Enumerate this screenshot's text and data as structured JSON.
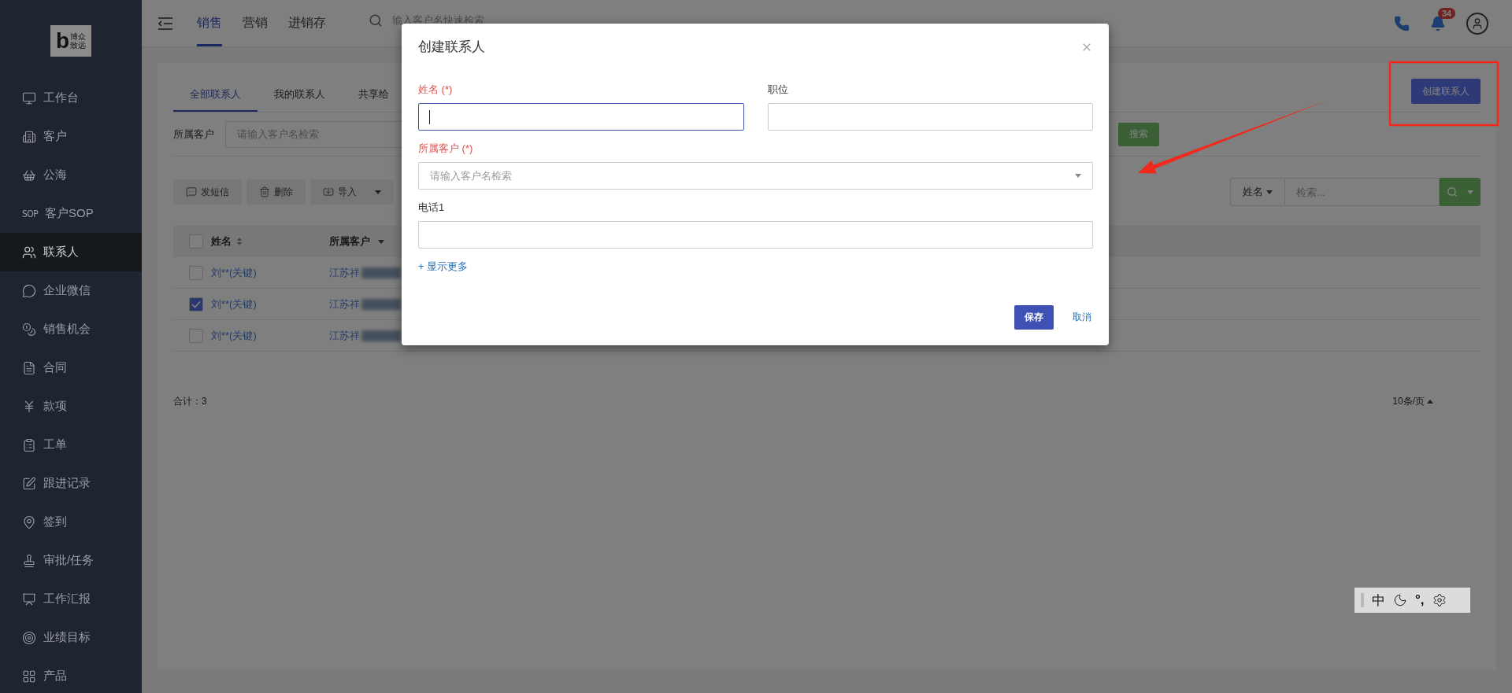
{
  "sidebar": {
    "logo": {
      "mark": "b",
      "text": "博众致远"
    },
    "items": [
      {
        "label": "工作台",
        "selected": false
      },
      {
        "label": "客户",
        "selected": false
      },
      {
        "label": "公海",
        "selected": false
      },
      {
        "label": "客户SOP",
        "icon_text": "SOP",
        "selected": false
      },
      {
        "label": "联系人",
        "selected": true
      },
      {
        "label": "企业微信",
        "selected": false
      },
      {
        "label": "销售机会",
        "selected": false
      },
      {
        "label": "合同",
        "selected": false
      },
      {
        "label": "款项",
        "selected": false
      },
      {
        "label": "工单",
        "selected": false
      },
      {
        "label": "跟进记录",
        "selected": false
      },
      {
        "label": "签到",
        "selected": false
      },
      {
        "label": "审批/任务",
        "selected": false
      },
      {
        "label": "工作汇报",
        "selected": false
      },
      {
        "label": "业绩目标",
        "selected": false
      },
      {
        "label": "产品",
        "selected": false
      }
    ]
  },
  "topbar": {
    "tabs": [
      {
        "label": "销售",
        "selected": true
      },
      {
        "label": "营销",
        "selected": false
      },
      {
        "label": "进销存",
        "selected": false
      }
    ],
    "search_placeholder": "输入客户名快速检索",
    "notification_count": "34"
  },
  "contacts": {
    "tabs": [
      {
        "label": "全部联系人",
        "selected": true
      },
      {
        "label": "我的联系人",
        "selected": false
      },
      {
        "label": "共享给",
        "selected": false
      }
    ],
    "create_button": "创建联系人",
    "filter": {
      "label": "所属客户",
      "placeholder": "请输入客户名检索",
      "button": "搜索"
    },
    "toolbar": [
      {
        "label": "发短信",
        "kind": "sms",
        "dropdown": false
      },
      {
        "label": "删除",
        "kind": "delete",
        "dropdown": false
      },
      {
        "label": "导入",
        "kind": "import",
        "dropdown": true
      }
    ],
    "search": {
      "field": "姓名",
      "placeholder": "检索..."
    },
    "table": {
      "all_selected": false,
      "columns": [
        {
          "label": "姓名",
          "kind": "sortable"
        },
        {
          "label": "所属客户",
          "kind": "filter"
        }
      ],
      "rows": [
        {
          "selected": false,
          "name": "刘**(关键)",
          "customer": "江苏祥",
          "redacted": true
        },
        {
          "selected": true,
          "name": "刘**(关键)",
          "customer": "江苏祥",
          "redacted": true
        },
        {
          "selected": false,
          "name": "刘**(关键)",
          "customer": "江苏祥",
          "redacted": true
        }
      ]
    },
    "total": "合计：3",
    "page_size": "10条/页"
  },
  "dialog": {
    "title": "创建联系人",
    "rows": [
      [
        {
          "label": "姓名 (*)",
          "required": true,
          "kind": "text",
          "focused": true
        },
        {
          "label": "职位",
          "required": false,
          "kind": "text",
          "focused": false
        }
      ],
      [
        {
          "label": "所属客户 (*)",
          "required": true,
          "kind": "select",
          "placeholder": "请输入客户名检索",
          "focused": false
        }
      ],
      [
        {
          "label": "电话1",
          "required": false,
          "kind": "text",
          "focused": false
        }
      ]
    ],
    "more_link": "+ 显示更多",
    "buttons": [
      {
        "label": "保存",
        "kind": "primary"
      },
      {
        "label": "取消",
        "kind": "link"
      }
    ]
  },
  "annotations": {
    "frame": true,
    "arrow": true
  },
  "ime": {
    "mode": "中",
    "punctuation": "°,"
  }
}
